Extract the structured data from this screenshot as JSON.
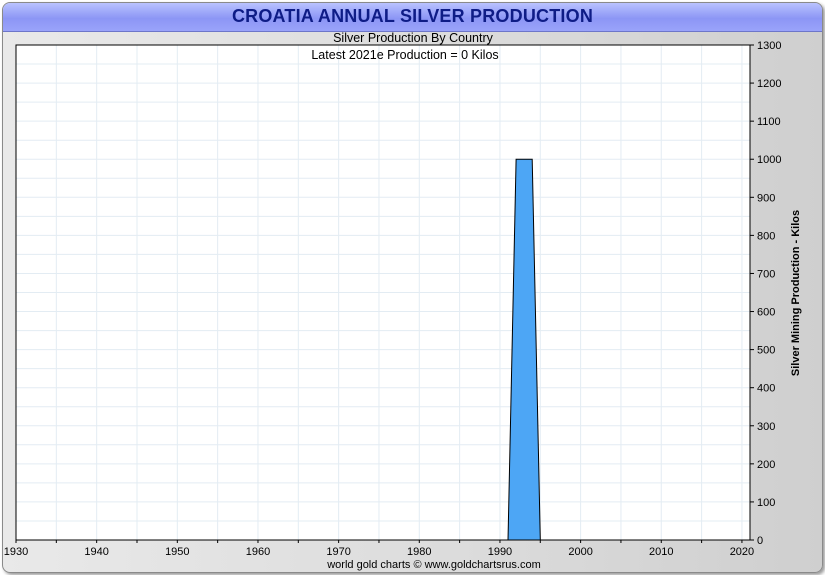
{
  "header": {
    "title": "CROATIA ANNUAL SILVER PRODUCTION"
  },
  "chart_data": {
    "type": "area",
    "title": "CROATIA ANNUAL SILVER PRODUCTION",
    "subtitle": "Silver Production By Country",
    "annotation": "Latest 2021e Production = 0 Kilos",
    "xlabel": "",
    "ylabel": "Silver Mining Production - Kilos",
    "xlim": [
      1930,
      2021
    ],
    "ylim": [
      0,
      1300
    ],
    "x_ticks": [
      1930,
      1940,
      1950,
      1960,
      1970,
      1980,
      1990,
      2000,
      2010,
      2020
    ],
    "y_ticks": [
      0,
      100,
      200,
      300,
      400,
      500,
      600,
      700,
      800,
      900,
      1000,
      1100,
      1200,
      1300
    ],
    "y_axis_side": "right",
    "grid": true,
    "series": [
      {
        "color": "#4da6f5",
        "x": [
          1991,
          1992,
          1994,
          1995
        ],
        "y": [
          0,
          1000,
          1000,
          0
        ]
      }
    ],
    "credit": "world gold charts © www.goldchartsrus.com"
  }
}
